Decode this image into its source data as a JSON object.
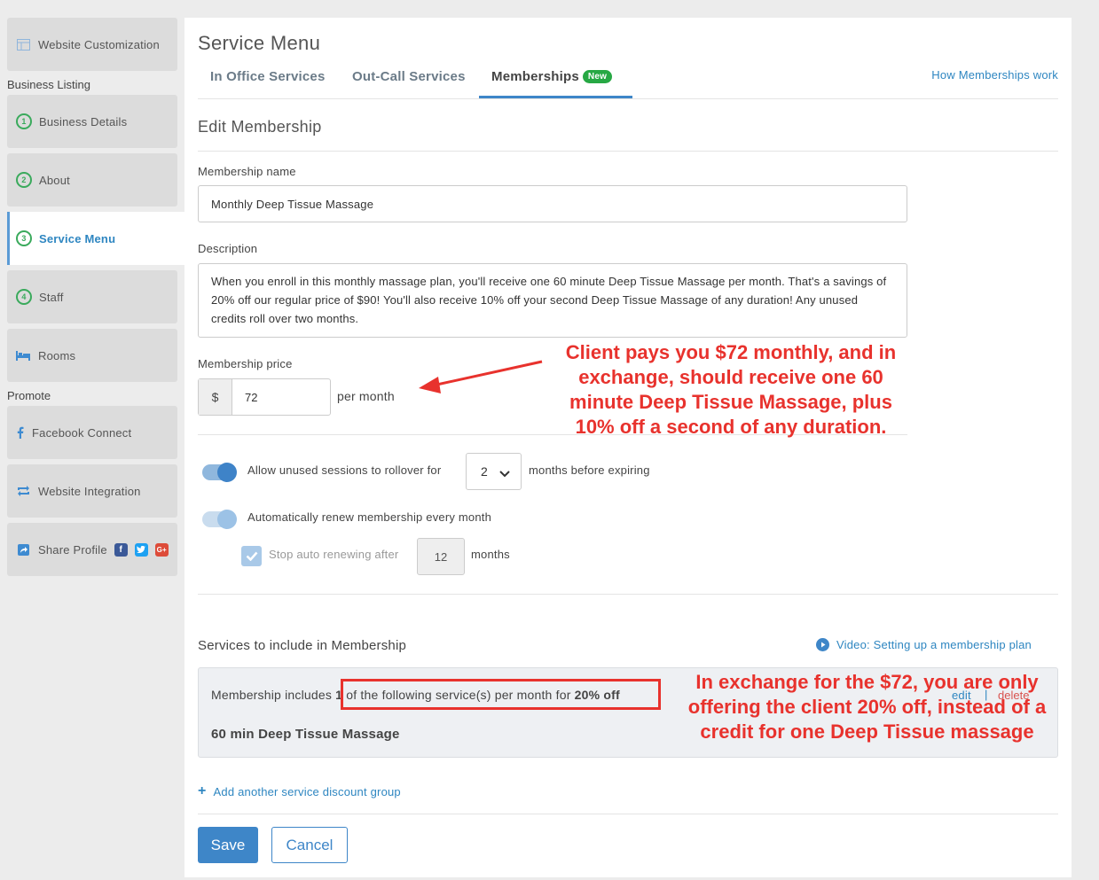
{
  "sidebar": {
    "top_item": "Website Customization",
    "group_business": "Business Listing",
    "items": [
      {
        "num": "1",
        "label": "Business Details"
      },
      {
        "num": "2",
        "label": "About"
      },
      {
        "num": "3",
        "label": "Service Menu"
      },
      {
        "num": "4",
        "label": "Staff"
      }
    ],
    "rooms": "Rooms",
    "group_promote": "Promote",
    "facebook": "Facebook Connect",
    "integration": "Website Integration",
    "share": "Share Profile",
    "social_icons": [
      "facebook-icon",
      "twitter-icon",
      "google-plus-icon"
    ]
  },
  "header": {
    "title": "Service Menu",
    "tabs": [
      "In Office Services",
      "Out-Call Services",
      "Memberships"
    ],
    "new_badge": "New",
    "help_link": "How Memberships work"
  },
  "form": {
    "section_title": "Edit Membership",
    "name_label": "Membership name",
    "name_value": "Monthly Deep Tissue Massage",
    "description_label": "Description",
    "description_value": "When you enroll in this monthly massage plan, you'll receive one 60 minute Deep Tissue Massage per month. That's a savings of 20% off our regular price of $90! You'll also receive 10% off your second Deep Tissue Massage of any duration! Any unused credits roll over two months.",
    "price_label": "Membership price",
    "currency": "$",
    "price_value": "72",
    "price_suffix": "per month",
    "rollover_label": "Allow unused sessions to rollover for",
    "rollover_value": "2",
    "rollover_suffix": "months before expiring",
    "renew_label": "Automatically renew membership every month",
    "stop_label": "Stop auto renewing after",
    "stop_value": "12",
    "stop_suffix": "months"
  },
  "services": {
    "title": "Services to include in Membership",
    "video_link": "Video: Setting up a membership plan",
    "includes_prefix": "Membership includes ",
    "includes_count": "1",
    "includes_middle": " of the following service(s) per month for ",
    "includes_discount": "20% off",
    "edit": "edit",
    "delete": "delete",
    "service_name": "60 min Deep Tissue Massage",
    "add_group": "Add another service discount group"
  },
  "buttons": {
    "save": "Save",
    "cancel": "Cancel"
  },
  "annotations": {
    "price_note": [
      "Client pays you $72 monthly, and in",
      "exchange, should receive one 60",
      "minute Deep Tissue Massage, plus",
      "10% off a second of any duration."
    ],
    "discount_note": [
      "In exchange for the $72, you are only",
      "offering the client 20% off, instead of a",
      "credit for one Deep Tissue massage"
    ]
  },
  "colors": {
    "accent": "#3e86c8",
    "annotation": "#e8322d",
    "badge_green": "#27a844"
  }
}
